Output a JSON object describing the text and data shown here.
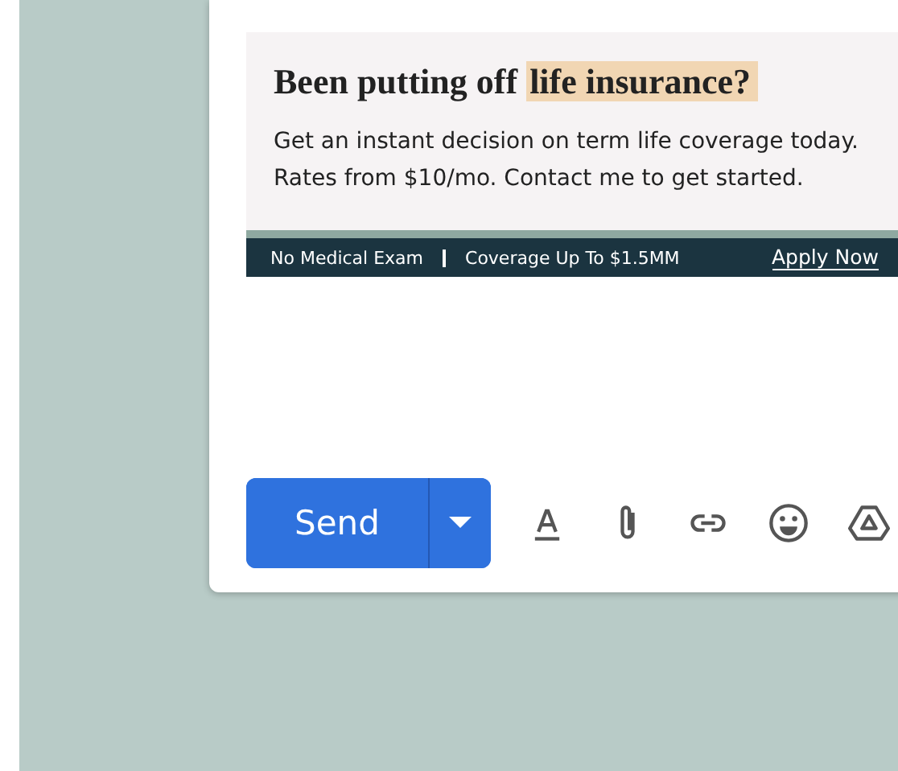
{
  "ad": {
    "headline": "Been putting off",
    "highlight": "life insurance?",
    "body": "Get an instant decision on term life coverage today. Rates from $10/mo. Contact me to get started.",
    "features": [
      "No Medical Exam",
      "Coverage Up To $1.5MM"
    ],
    "link": "Apply Now"
  },
  "send_button": {
    "label": "Send"
  },
  "toolbar": [
    {
      "kind": "format"
    },
    {
      "kind": "attach"
    },
    {
      "kind": "link"
    },
    {
      "kind": "emoji"
    },
    {
      "kind": "drive"
    }
  ]
}
